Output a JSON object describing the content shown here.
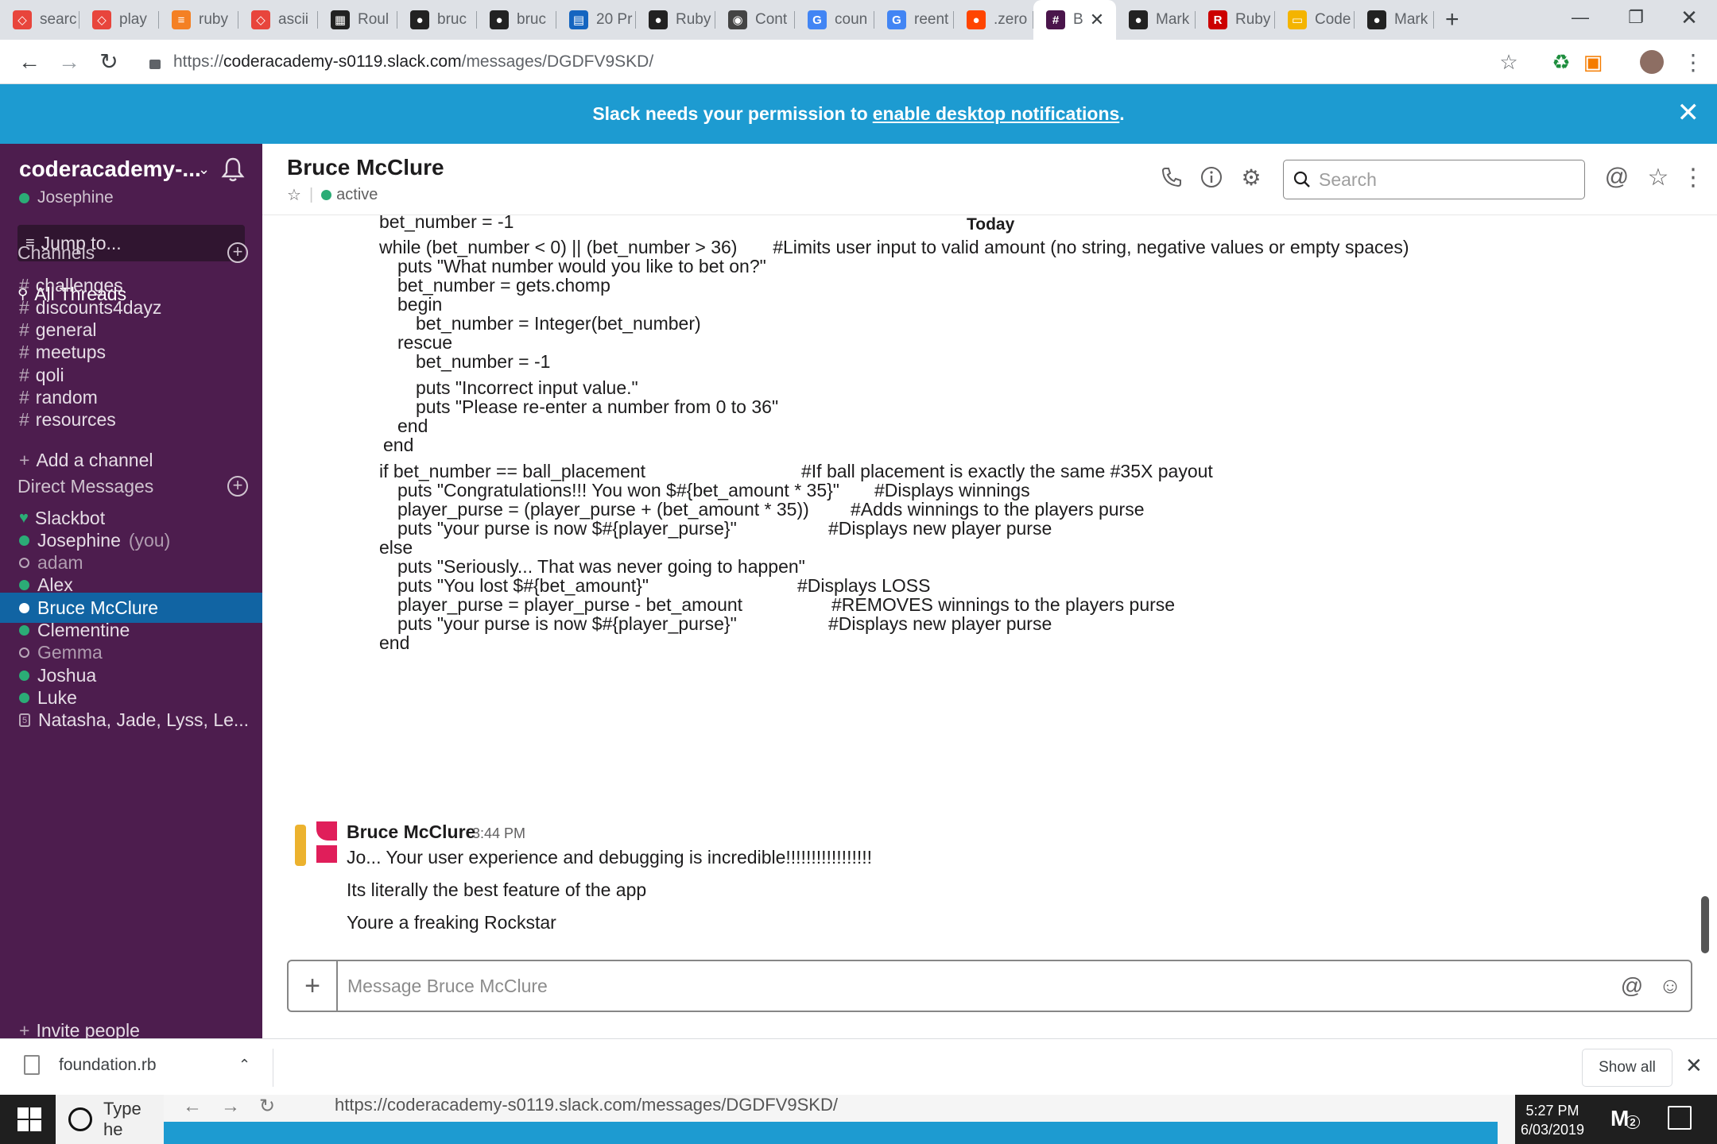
{
  "browser": {
    "tabs": [
      {
        "label": "searc",
        "icon": "shield-icon",
        "color": "#e8453c"
      },
      {
        "label": "play",
        "icon": "shield-icon",
        "color": "#e8453c"
      },
      {
        "label": "ruby",
        "icon": "stackoverflow-icon",
        "color": "#f48024"
      },
      {
        "label": "ascii",
        "icon": "shield-icon",
        "color": "#e8453c"
      },
      {
        "label": "Roul",
        "icon": "trello-icon",
        "color": "#222222"
      },
      {
        "label": "bruc",
        "icon": "github-icon",
        "color": "#222222"
      },
      {
        "label": "bruc",
        "icon": "github-icon",
        "color": "#222222"
      },
      {
        "label": "20 Pr",
        "icon": "doc-icon",
        "color": "#1565c0"
      },
      {
        "label": "Ruby",
        "icon": "github-icon",
        "color": "#222222"
      },
      {
        "label": "Cont",
        "icon": "lock-circle-icon",
        "color": "#444444"
      },
      {
        "label": "coun",
        "icon": "google-icon",
        "color": "#4285f4"
      },
      {
        "label": "reent",
        "icon": "google-icon",
        "color": "#4285f4"
      },
      {
        "label": ".zero",
        "icon": "reddit-icon",
        "color": "#ff4500"
      },
      {
        "label": "B",
        "icon": "slack-icon",
        "color": "#4a154b",
        "active": true
      },
      {
        "label": "Mark",
        "icon": "github-icon",
        "color": "#222222"
      },
      {
        "label": "Ruby",
        "icon": "r-icon",
        "color": "#cc0000"
      },
      {
        "label": "Code",
        "icon": "slides-icon",
        "color": "#f4b400"
      },
      {
        "label": "Mark",
        "icon": "github-icon",
        "color": "#222222"
      }
    ],
    "url_prefix": "https://",
    "url_host": "coderacademy-s0119.slack.com",
    "url_path": "/messages/DGDFV9SKD/",
    "extension_badge": "0"
  },
  "banner": {
    "text": "Slack needs your permission to",
    "link": "enable desktop notifications",
    "suffix": "."
  },
  "sidebar": {
    "team_name": "coderacademy-...",
    "user": "Josephine",
    "jump_to": "Jump to...",
    "all_threads": "All Threads",
    "channels_heading": "Channels",
    "channels": [
      "challenges",
      "discounts4dayz",
      "general",
      "meetups",
      "qoli",
      "random",
      "resources"
    ],
    "add_channel": "Add a channel",
    "dm_heading": "Direct Messages",
    "dms": [
      {
        "name": "Slackbot",
        "status": "heart"
      },
      {
        "name": "Josephine",
        "status": "on",
        "suffix": "(you)"
      },
      {
        "name": "adam",
        "status": "off"
      },
      {
        "name": "Alex",
        "status": "on"
      },
      {
        "name": "Bruce McClure",
        "status": "on",
        "selected": true
      },
      {
        "name": "Clementine",
        "status": "on"
      },
      {
        "name": "Gemma",
        "status": "off"
      },
      {
        "name": "Joshua",
        "status": "on"
      },
      {
        "name": "Luke",
        "status": "on"
      },
      {
        "name": "Natasha, Jade, Lyss, Le...",
        "status": "group"
      }
    ],
    "invite": "Invite people"
  },
  "header": {
    "title": "Bruce McClure",
    "status": "active",
    "search_placeholder": "Search"
  },
  "messages": {
    "date_divider": "Today",
    "code_lines": [
      "bet_number = -1",
      "while (bet_number < 0) || (bet_number > 36)       #Limits user input to valid amount (no string, negative values or empty spaces)",
      "puts \"What number would you like to bet on?\"",
      "bet_number = gets.chomp",
      "begin",
      "bet_number = Integer(bet_number)",
      "rescue",
      "bet_number = -1",
      "puts \"Incorrect input value.\"",
      "puts \"Please re-enter a number from 0 to 36\"",
      "end",
      "end",
      "if bet_number == ball_placement",
      "#If ball placement is exactly the same #35X payout",
      "puts \"Congratulations!!! You won $#{bet_amount * 35}\"",
      "#Displays winnings",
      "player_purse = (player_purse + (bet_amount * 35))",
      "#Adds winnings to the players purse",
      "puts \"your purse is now $#{player_purse}\"",
      "#Displays new player purse",
      "else",
      "puts \"Seriously... That was never going to happen\"",
      "puts \"You lost $#{bet_amount}\"",
      "#Displays LOSS",
      "player_purse = player_purse - bet_amount",
      "#REMOVES winnings to the players purse",
      "puts \"your purse is now $#{player_purse}\"",
      "#Displays new player purse",
      "end"
    ],
    "last_message": {
      "sender": "Bruce McClure",
      "time": "3:44 PM",
      "lines": [
        "Jo... Your user experience and debugging is incredible!!!!!!!!!!!!!!!!!",
        "Its literally the best feature of the app",
        "Youre a freaking Rockstar"
      ]
    }
  },
  "composer": {
    "placeholder": "Message Bruce McClure"
  },
  "downloads": {
    "file": "foundation.rb",
    "show_all": "Show all"
  },
  "taskbar": {
    "search_text": "Type he",
    "thumb_url": "https://coderacademy-s0119.slack.com/messages/DGDFV9SKD/",
    "time": "5:27 PM",
    "date": "6/03/2019",
    "notification_count": "2"
  },
  "colors": {
    "sidebar_bg": "#4d1d4e",
    "selected_item": "#1164a3",
    "banner_bg": "#1d9bd1",
    "presence_green": "#2bac76"
  }
}
